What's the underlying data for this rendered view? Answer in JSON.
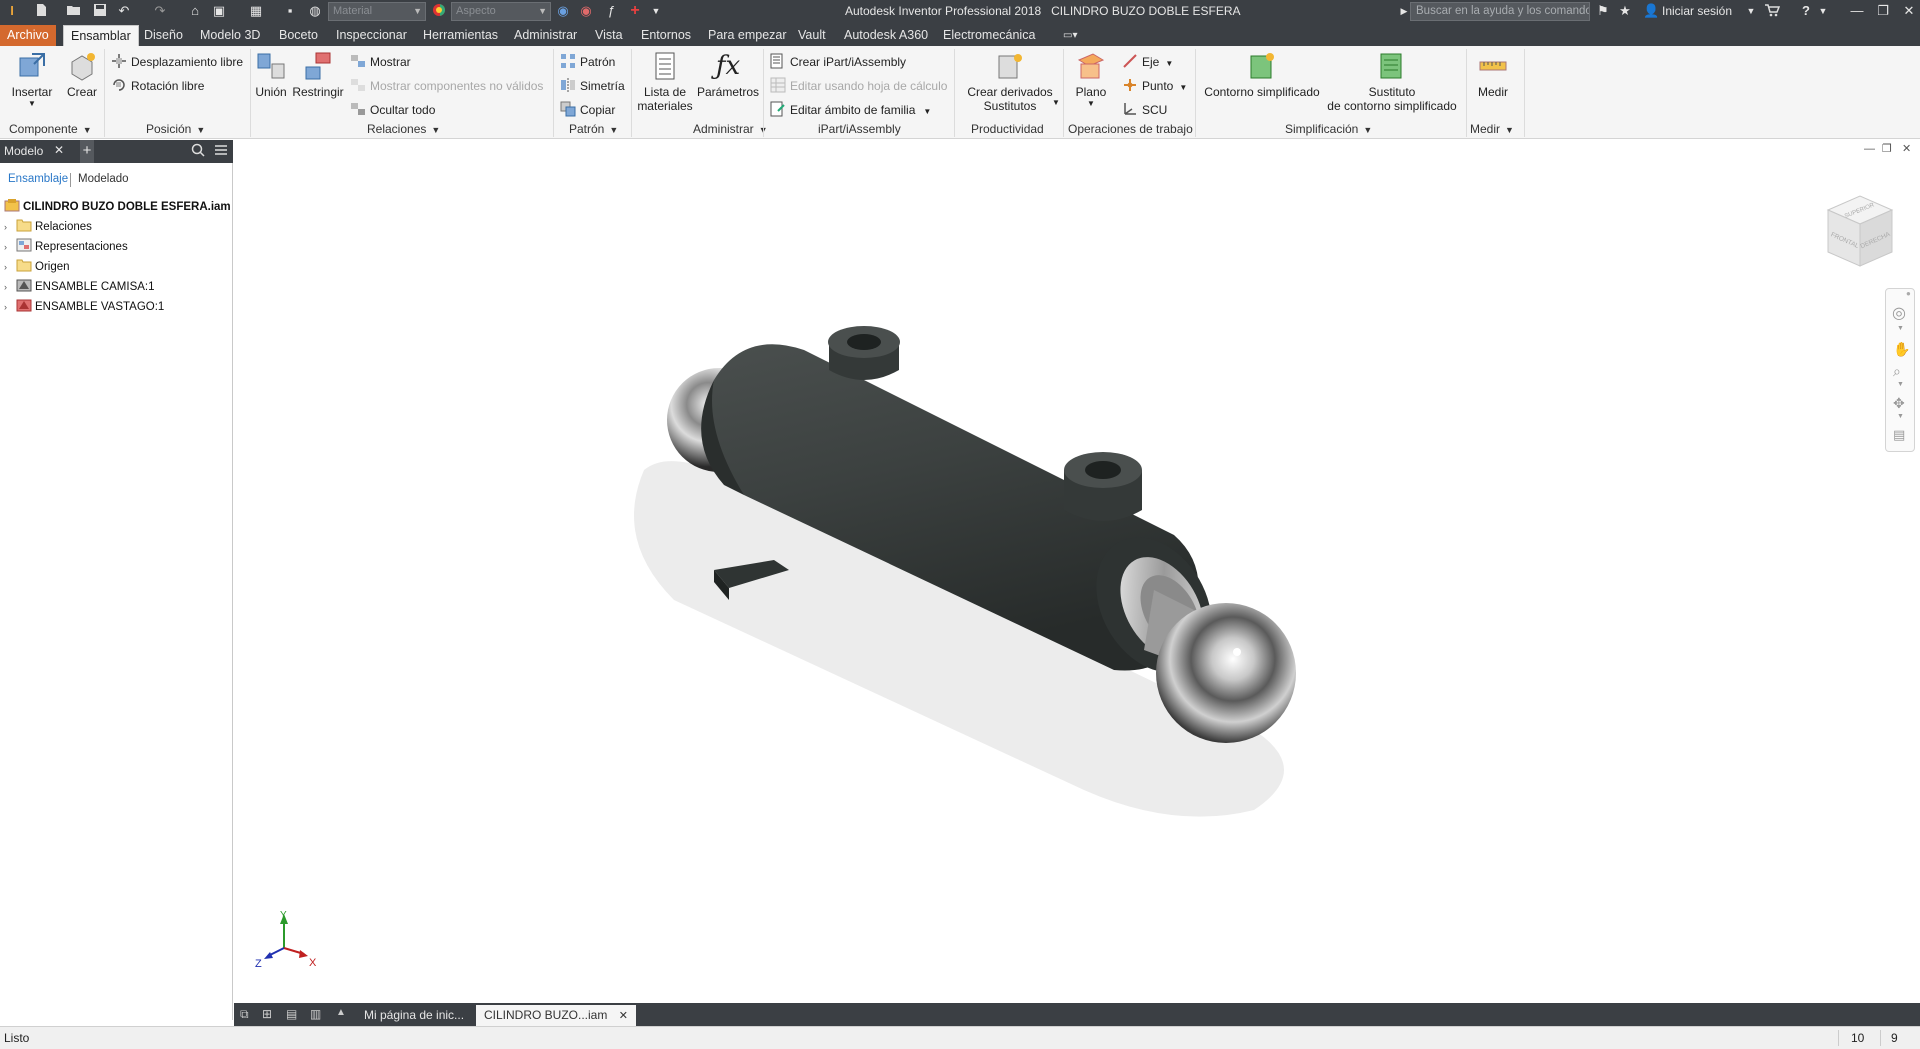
{
  "titlebar": {
    "app_title": "Autodesk Inventor Professional 2018",
    "document_title": "CILINDRO BUZO DOBLE ESFERA",
    "material_placeholder": "Material",
    "appearance_placeholder": "Aspecto",
    "search_placeholder": "Buscar en la ayuda y los comandos...",
    "signin_label": "Iniciar sesión",
    "icons": [
      "new-icon",
      "open-icon",
      "save-icon",
      "undo-icon",
      "redo-icon",
      "home-icon",
      "return-icon",
      "select-icon",
      "update-icon",
      "color-icon",
      "adjust-icon",
      "clear-override-icon",
      "parameters-fx-icon",
      "add-icon",
      "cart-icon",
      "help-icon",
      "minimize-icon",
      "restore-icon",
      "close-icon"
    ]
  },
  "tabs": {
    "file": "Archivo",
    "items": [
      "Ensamblar",
      "Diseño",
      "Modelo 3D",
      "Boceto",
      "Inspeccionar",
      "Herramientas",
      "Administrar",
      "Vista",
      "Entornos",
      "Para empezar",
      "Vault",
      "Autodesk A360",
      "Electromecánica"
    ],
    "active": "Ensamblar"
  },
  "ribbon": {
    "componente": {
      "insertar": "Insertar",
      "crear": "Crear",
      "label": "Componente"
    },
    "posicion": {
      "desplazamiento": "Desplazamiento libre",
      "rotacion": "Rotación libre",
      "label": "Posición"
    },
    "relaciones": {
      "union": "Unión",
      "restringir": "Restringir",
      "mostrar": "Mostrar",
      "mostrar_no_validos": "Mostrar componentes no válidos",
      "ocultar_todo": "Ocultar todo",
      "label": "Relaciones"
    },
    "patron": {
      "patron": "Patrón",
      "simetria": "Simetría",
      "copiar": "Copiar",
      "label": "Patrón"
    },
    "administrar": {
      "lista_1": "Lista de",
      "lista_2": "materiales",
      "parametros": "Parámetros",
      "label": "Administrar"
    },
    "ipart": {
      "crear": "Crear iPart/iAssembly",
      "editar_hoja": "Editar usando hoja de cálculo",
      "editar_ambito": "Editar ámbito de familia",
      "label": "iPart/iAssembly"
    },
    "productividad": {
      "crear_1": "Crear derivados",
      "crear_2": "Sustitutos",
      "label": "Productividad"
    },
    "operaciones": {
      "plano": "Plano",
      "eje": "Eje",
      "punto": "Punto",
      "scu": "SCU",
      "label": "Operaciones de trabajo"
    },
    "simplificacion": {
      "contorno": "Contorno simplificado",
      "sustituto_1": "Sustituto",
      "sustituto_2": "de contorno simplificado",
      "label": "Simplificación"
    },
    "medir": {
      "medir": "Medir",
      "label": "Medir"
    }
  },
  "browser": {
    "title": "Modelo",
    "tab_ensamblaje": "Ensamblaje",
    "tab_modelado": "Modelado",
    "root": "CILINDRO BUZO DOBLE ESFERA.iam",
    "nodes": [
      "Relaciones",
      "Representaciones",
      "Origen",
      "ENSAMBLE CAMISA:1",
      "ENSAMBLE VASTAGO:1"
    ]
  },
  "viewcube": {
    "top": "SUPERIOR",
    "front": "FRONTAL",
    "right": "DERECHA"
  },
  "triad": {
    "x": "X",
    "y": "Y",
    "z": "Z"
  },
  "doc_tabs": [
    "Mi página de inic...",
    "CILINDRO BUZO...iam"
  ],
  "status": {
    "text": "Listo",
    "count_a": "10",
    "count_b": "9"
  },
  "colors": {
    "file_tab": "#d4692e",
    "chrome_dark": "#3b3f44",
    "ribbon_bg": "#f5f5f5",
    "model_body": "#3c4140"
  }
}
